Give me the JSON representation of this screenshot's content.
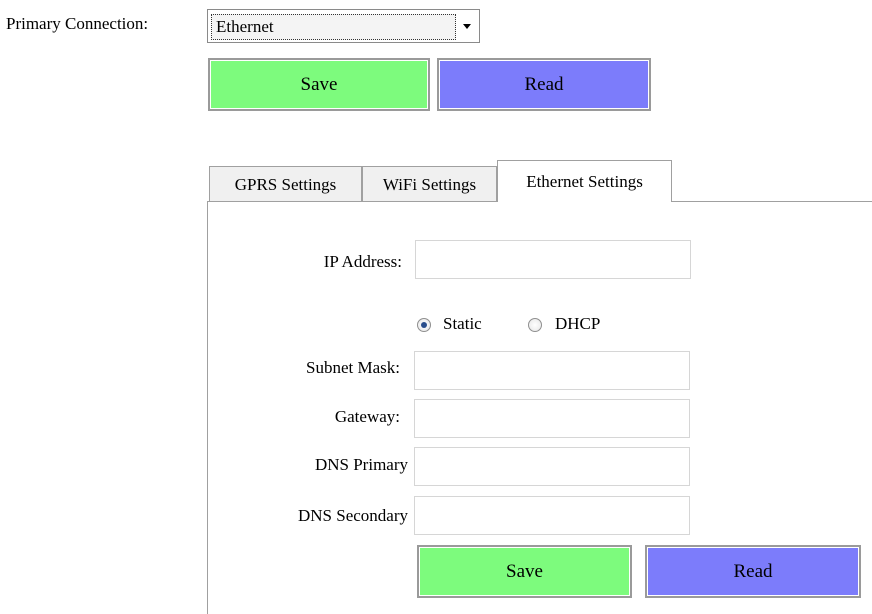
{
  "primary": {
    "label": "Primary Connection:",
    "selected": "Ethernet"
  },
  "top_buttons": {
    "save": "Save",
    "read": "Read"
  },
  "tabs": [
    {
      "label": "GPRS Settings",
      "active": false
    },
    {
      "label": "WiFi Settings",
      "active": false
    },
    {
      "label": "Ethernet Settings",
      "active": true
    }
  ],
  "ethernet": {
    "ip_label": "IP Address:",
    "ip_value": "",
    "mode_options": {
      "static": "Static",
      "dhcp": "DHCP"
    },
    "mode_selected": "Static",
    "subnet_label": "Subnet Mask:",
    "subnet_value": "",
    "gateway_label": "Gateway:",
    "gateway_value": "",
    "dns_primary_label": "DNS Primary",
    "dns_primary_value": "",
    "dns_secondary_label": "DNS Secondary",
    "dns_secondary_value": "",
    "save": "Save",
    "read": "Read"
  },
  "colors": {
    "save_button": "#7dfb7d",
    "read_button": "#7c7cfb"
  }
}
